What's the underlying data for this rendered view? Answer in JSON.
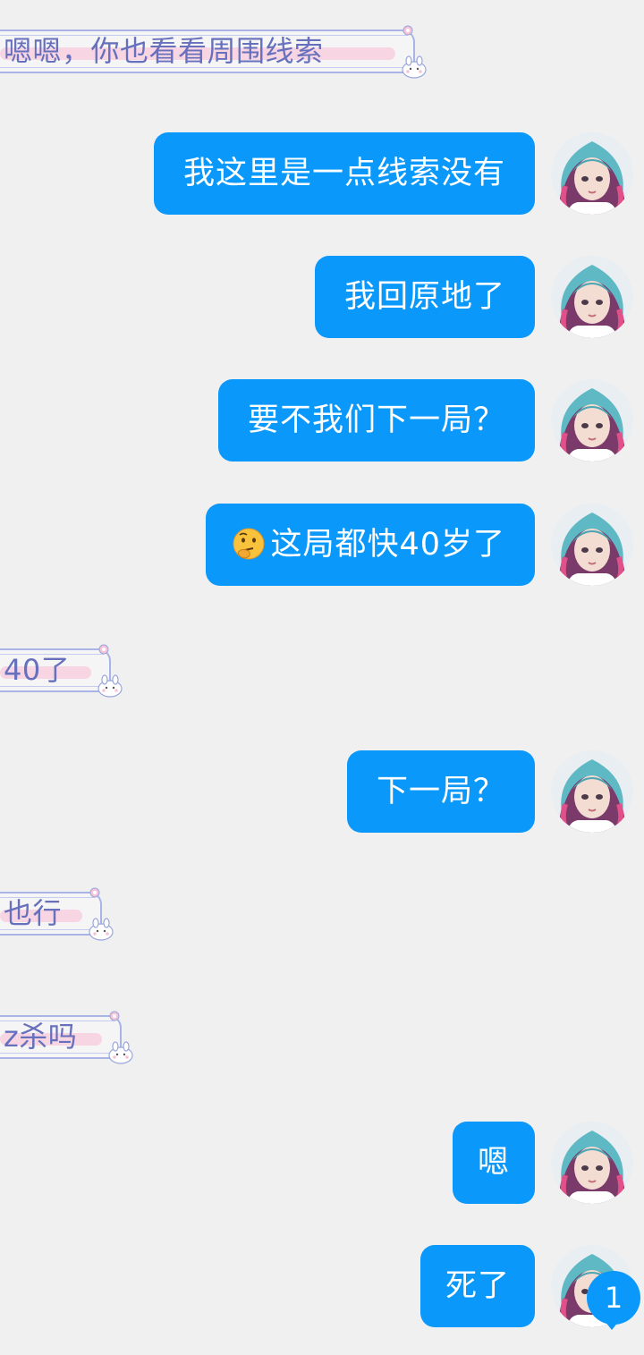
{
  "messages": [
    {
      "dir": "in",
      "text": "嗯嗯，你也看看周围线索"
    },
    {
      "dir": "out",
      "text": "我这里是一点线索没有"
    },
    {
      "dir": "out",
      "text": "我回原地了"
    },
    {
      "dir": "out",
      "text": "要不我们下一局？"
    },
    {
      "dir": "out",
      "text": "这局都快40岁了",
      "emoji": "thinking-face-emoji"
    },
    {
      "dir": "in",
      "text": "40了"
    },
    {
      "dir": "out",
      "text": "下一局？"
    },
    {
      "dir": "in",
      "text": "也行"
    },
    {
      "dir": "in",
      "text": "z杀吗"
    },
    {
      "dir": "out",
      "text": "嗯"
    },
    {
      "dir": "out",
      "text": "死了"
    }
  ],
  "avatar": {
    "icon": "anime-girl-avatar"
  },
  "unread_badge": {
    "count": "1"
  },
  "colors": {
    "background": "#f0f0f0",
    "outgoing_bubble": "#0a98fb",
    "incoming_text": "#6670bc",
    "incoming_frame": "#a9b3e6",
    "incoming_highlight": "#f8d2e0"
  }
}
